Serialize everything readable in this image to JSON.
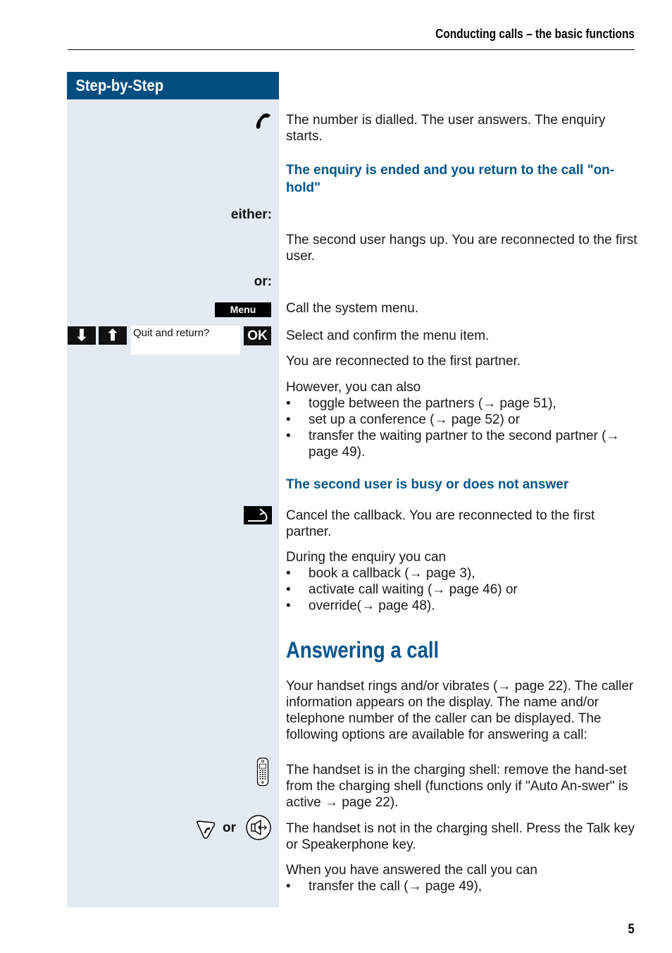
{
  "header": {
    "running_head": "Conducting calls – the basic functions",
    "page_number": "5"
  },
  "sidebar": {
    "title": "Step-by-Step",
    "labels": {
      "either": "either:",
      "or": "or:",
      "or_inline": "or"
    },
    "keys": {
      "menu": "Menu",
      "down": "⬇",
      "up": "⬆",
      "ok": "OK"
    },
    "display_text": "Quit and return?"
  },
  "content": {
    "dial_text": "The number is dialled. The user answers. The enquiry starts.",
    "heading_return": "The enquiry is ended and you return to the call \"on-hold\"",
    "hangup_text": "The second user hangs up. You are reconnected to the first user.",
    "call_menu_text": "Call the system menu.",
    "select_confirm_text": "Select and confirm the menu item.",
    "reconnected_text": "You are reconnected to the first partner.",
    "however_intro": "However, you can also",
    "however_items": [
      "toggle between the partners (→ page 51),",
      "set up a conference (→ page 52) or",
      "transfer the waiting partner to the second partner (→ page 49)."
    ],
    "heading_busy": "The second user is busy or does not answer",
    "cancel_callback_text": "Cancel the callback. You are reconnected to the first partner.",
    "during_intro": "During the enquiry you can",
    "during_items": [
      "book a callback (→ page 3),",
      "activate call waiting (→ page 46) or",
      "override(→ page 48)."
    ],
    "section_title": "Answering a call",
    "answer_intro": "Your handset rings and/or vibrates (→ page 22). The caller information appears on the display. The name and/or telephone number of the caller can be displayed. The following options are available for answering a call:",
    "charging_shell_text": "The handset is in the charging shell: remove the hand-set from the charging shell (functions only if \"Auto An-swer\" is active → page 22).",
    "not_in_shell_text": "The handset is not in the charging shell. Press the Talk key or Speakerphone key.",
    "answered_intro": "When you have answered the call you can",
    "answered_items": [
      "transfer the call (→ page 49),"
    ]
  },
  "colors": {
    "accent": "#00558c",
    "sidebar_header": "#004d80",
    "sidebar_bg": "#e3eaf2"
  }
}
